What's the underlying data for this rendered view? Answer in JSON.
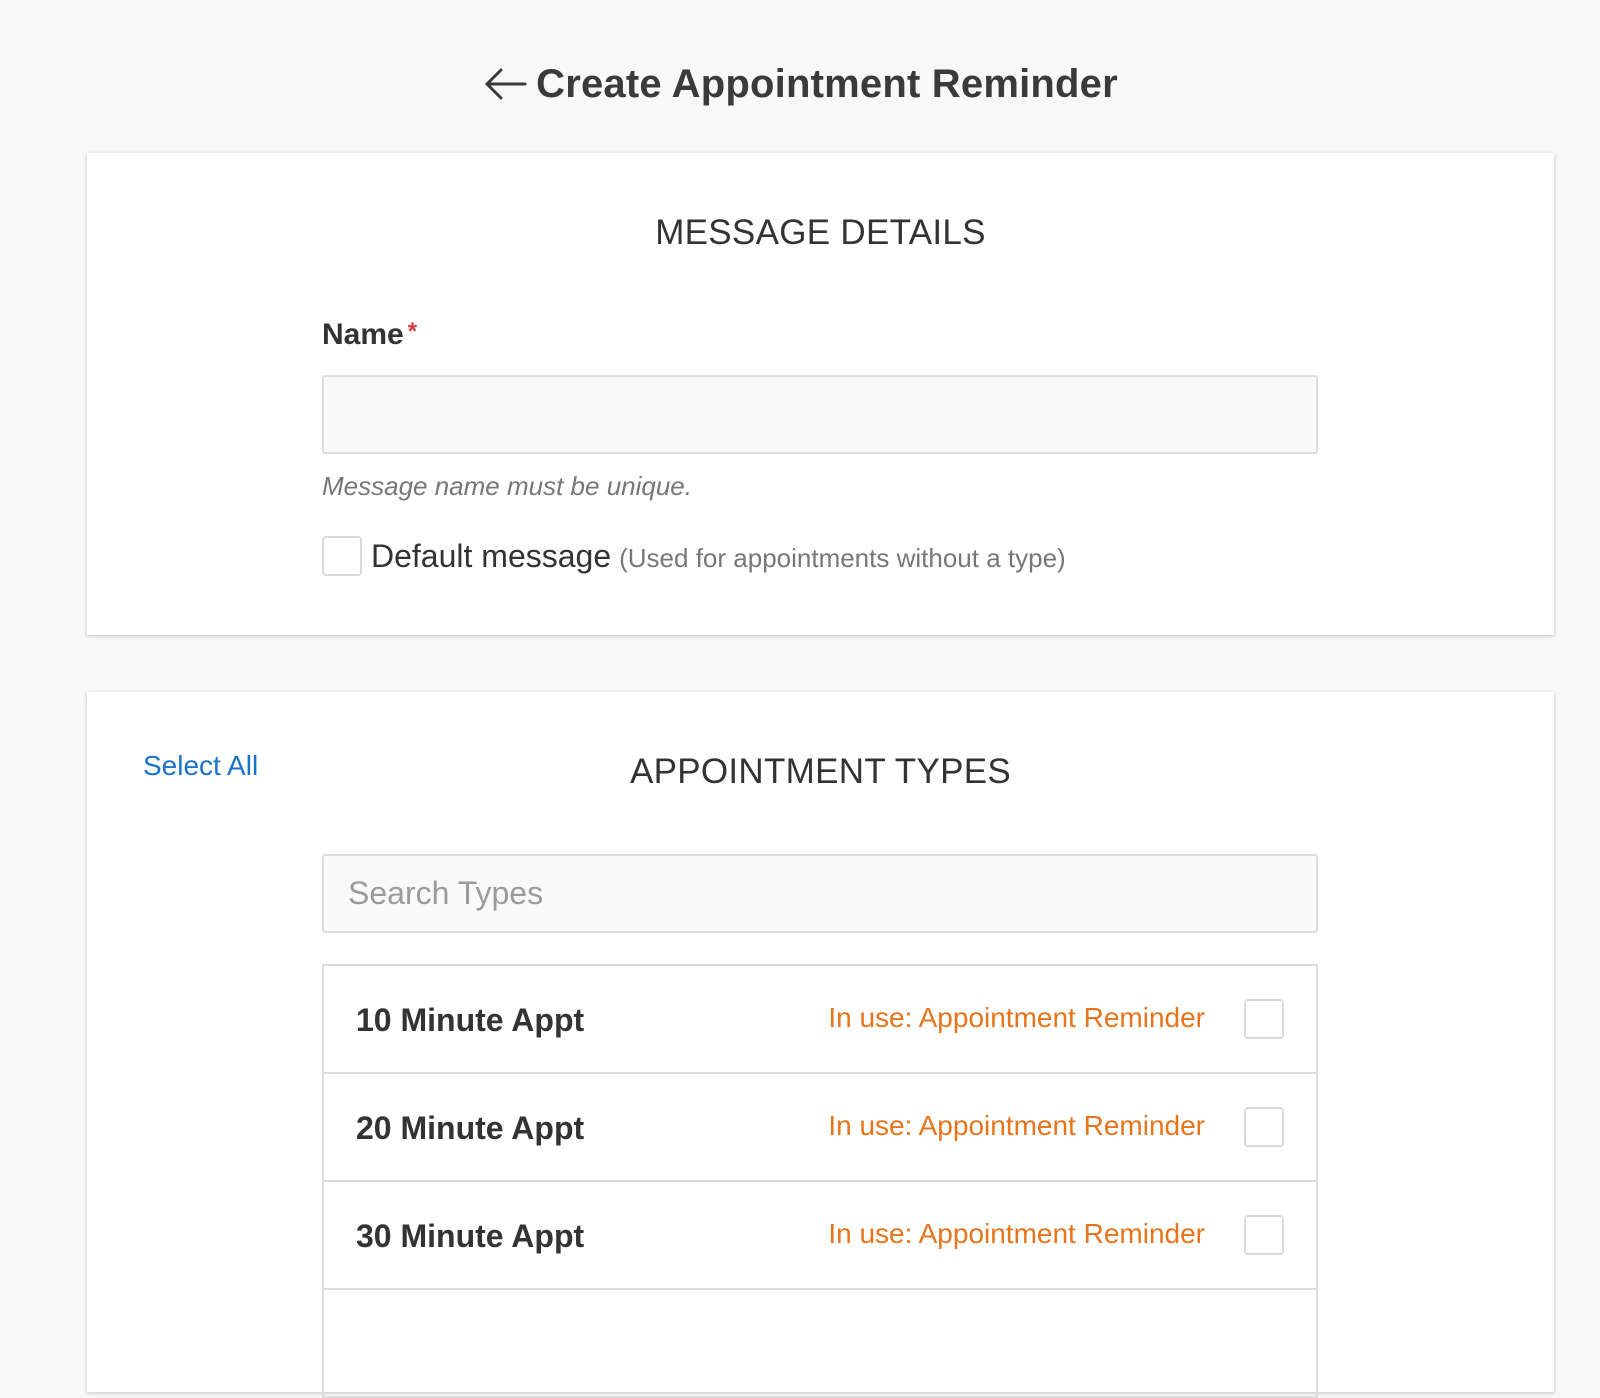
{
  "header": {
    "back_icon": "arrow-left-icon",
    "title": "Create Appointment Reminder"
  },
  "message_details": {
    "section_title": "MESSAGE DETAILS",
    "name_label": "Name",
    "required_marker": "*",
    "name_value": "",
    "name_placeholder": "",
    "help_text": "Message name must be unique.",
    "default_message": {
      "label": "Default message",
      "hint": "(Used for appointments without a type)",
      "checked": false
    }
  },
  "appointment_types": {
    "select_all_label": "Select All",
    "section_title": "APPOINTMENT TYPES",
    "search_placeholder": "Search Types",
    "search_value": "",
    "items": [
      {
        "name": "10 Minute Appt",
        "status": "In use: Appointment Reminder",
        "checked": false
      },
      {
        "name": "20 Minute Appt",
        "status": "In use: Appointment Reminder",
        "checked": false
      },
      {
        "name": "30 Minute Appt",
        "status": "In use: Appointment Reminder",
        "checked": false
      },
      {
        "name": "",
        "status": "",
        "checked": false
      }
    ]
  },
  "colors": {
    "background": "#f8f8f8",
    "card": "#ffffff",
    "accent_link": "#1a73c8",
    "status_orange": "#e8741b",
    "required_red": "#d0393e",
    "text_primary": "#333333",
    "text_muted": "#777777"
  }
}
